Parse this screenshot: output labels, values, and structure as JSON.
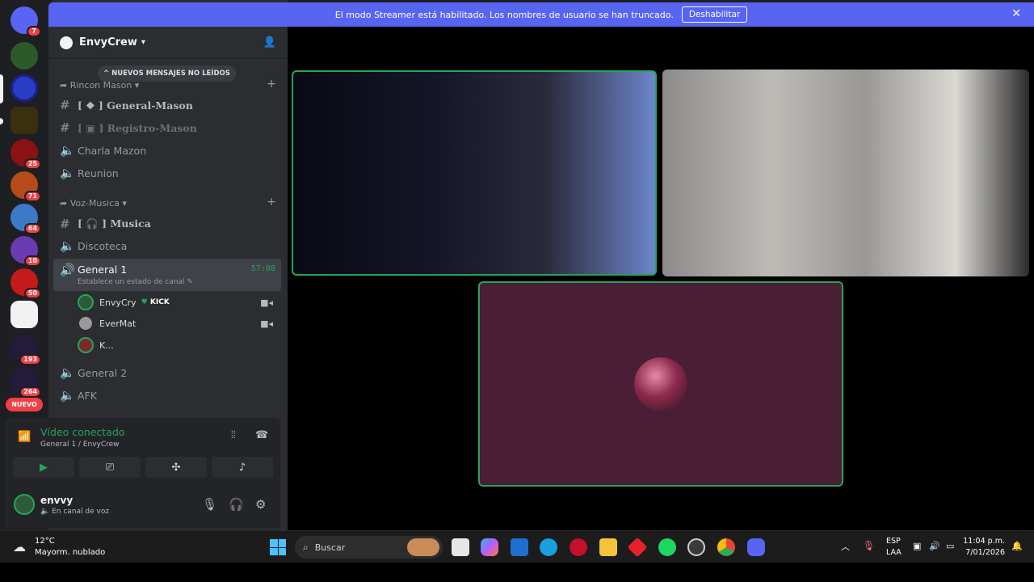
{
  "colors": {
    "accent": "#5865f2",
    "online": "#23a55a",
    "danger": "#f23f43"
  },
  "rail": {
    "home_badge": "7",
    "server_badges": [
      "25",
      "71",
      "64",
      "10",
      "50",
      "193",
      "264"
    ],
    "new_badge": "NUEVO"
  },
  "banner": {
    "text": "El modo Streamer está habilitado. Los nombres de usuario se han truncado.",
    "button": "Deshabilitar"
  },
  "guild": {
    "name": "EnvyCrew"
  },
  "unread_pill": "NUEVOS MENSAJES NO LEÍDOS",
  "categories": {
    "rincon": "Rincon Mason",
    "voz": "Voz-Musica"
  },
  "channels": {
    "general_mason": "[ ❖ ] General-Mason",
    "registro_mason": "[ ▣ ] Registro-Mason",
    "charla": "Charla Mazon",
    "reunion": "Reunion",
    "musica": "[ 🎧 ] Musica",
    "discoteca": "Discoteca",
    "general1": "General 1",
    "general1_time": "57:08",
    "general1_status": "Establece un estado de canal ✎",
    "general2": "General 2",
    "afk": "AFK"
  },
  "voice_users": [
    {
      "name": "EnvyCry",
      "tag": "KICK"
    },
    {
      "name": "EverMat"
    },
    {
      "name": "K..."
    }
  ],
  "voice_panel": {
    "status": "Vídeo conectado",
    "location": "General 1 / EnvyCrew"
  },
  "user": {
    "name": "envvy",
    "status": "En canal de voz"
  },
  "taskbar": {
    "temp": "12°C",
    "weather": "Mayorm. nublado",
    "search_placeholder": "Buscar",
    "lang1": "ESP",
    "lang2": "LAA",
    "time": "11:04 p.m.",
    "date": "7/01/2026"
  }
}
